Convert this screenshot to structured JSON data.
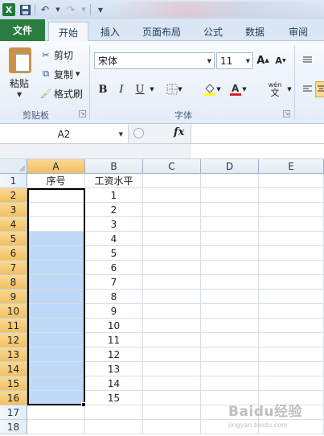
{
  "qat": {
    "app_icon": "X",
    "save_icon": "save-icon",
    "undo_icon": "undo-icon",
    "redo_icon": "redo-icon",
    "customize_icon": "customize-icon"
  },
  "tabs": [
    {
      "label": "文件",
      "kind": "file"
    },
    {
      "label": "开始",
      "kind": "active"
    },
    {
      "label": "插入",
      "kind": ""
    },
    {
      "label": "页面布局",
      "kind": ""
    },
    {
      "label": "公式",
      "kind": ""
    },
    {
      "label": "数据",
      "kind": ""
    },
    {
      "label": "审阅",
      "kind": ""
    }
  ],
  "ribbon": {
    "clipboard": {
      "paste": "粘贴",
      "cut": "剪切",
      "copy": "复制",
      "format_painter": "格式刷",
      "group_label": "剪贴板"
    },
    "font": {
      "font_name": "宋体",
      "font_size": "11",
      "bold": "B",
      "italic": "I",
      "underline": "U",
      "grow": "A",
      "shrink": "A",
      "phonetic": "wén",
      "phonetic_sub": "文",
      "group_label": "字体"
    }
  },
  "formula_bar": {
    "name_box": "A2",
    "fx": "fx",
    "formula": ""
  },
  "colors": {
    "selection": "#bfdaf7",
    "header_selected": "#f2c160",
    "file_tab": "#2a7d3f"
  },
  "sheet": {
    "columns": [
      "A",
      "B",
      "C",
      "D",
      "E"
    ],
    "rows": [
      "1",
      "2",
      "3",
      "4",
      "5",
      "6",
      "7",
      "8",
      "9",
      "10",
      "11",
      "12",
      "13",
      "14",
      "15",
      "16",
      "17",
      "18"
    ],
    "cells": {
      "A1": "序号",
      "B1": "工资水平",
      "B2": "1",
      "B3": "2",
      "B4": "3",
      "B5": "4",
      "B6": "5",
      "B7": "6",
      "B8": "7",
      "B9": "8",
      "B10": "9",
      "B11": "10",
      "B12": "11",
      "B13": "12",
      "B14": "13",
      "B15": "14",
      "B16": "15"
    },
    "selection": {
      "column": "A",
      "from_row": 2,
      "to_row": 16,
      "active": "A2"
    }
  },
  "watermark": {
    "text": "Baidu经验",
    "sub": "jingyan.baidu.com"
  }
}
